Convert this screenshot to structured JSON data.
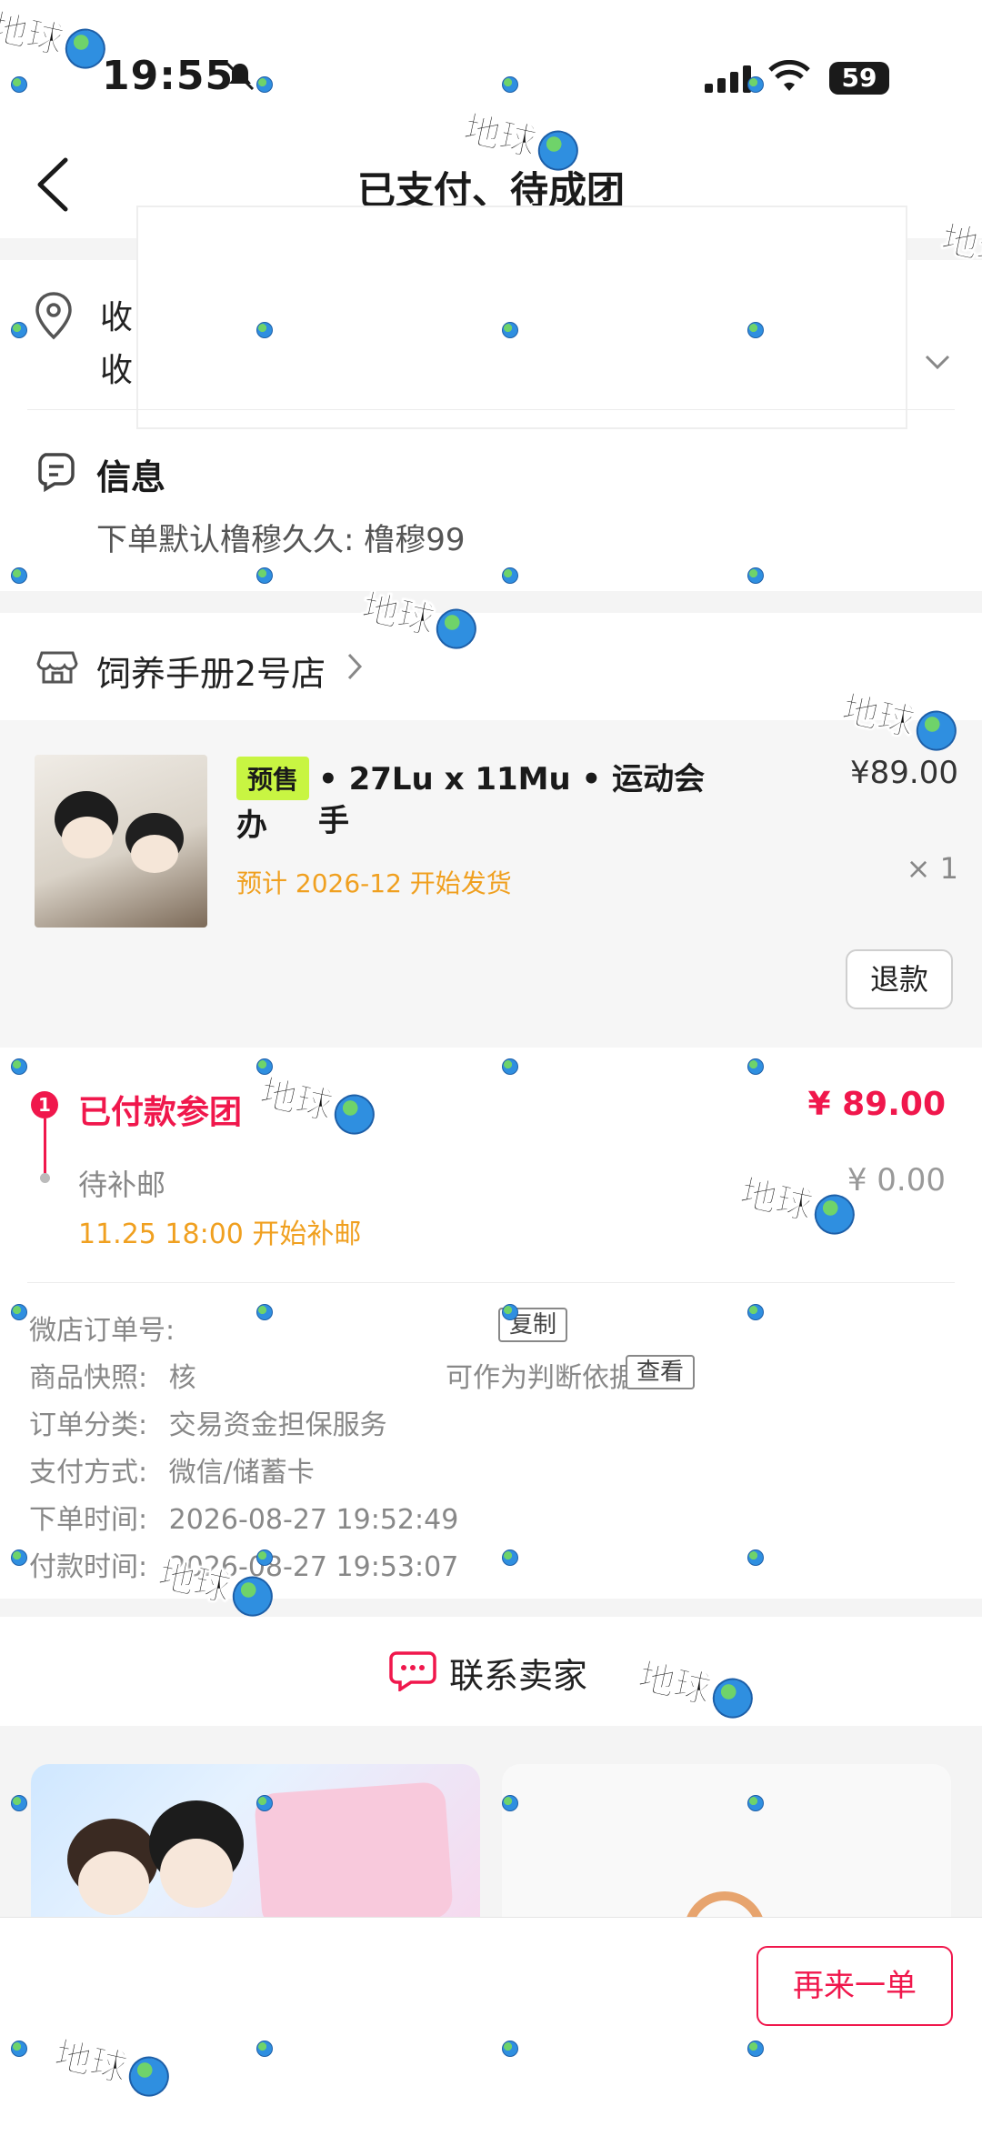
{
  "status_bar": {
    "time": "19:55",
    "battery": "59"
  },
  "nav": {
    "title": "已支付、待成团"
  },
  "address": {
    "line1": "收",
    "line2": "收"
  },
  "info": {
    "title": "信息",
    "text": "下单默认橹穆久久: 橹穆99"
  },
  "shop": {
    "name": "饲养手册2号店"
  },
  "product": {
    "tag": "预售",
    "title": "• 27Lu x 11Mu • 运动会手",
    "title_wrap": "办",
    "ship_note": "预计 2026-12 开始发货",
    "price": "¥89.00",
    "qty": "× 1",
    "refund_label": "退款"
  },
  "payment": {
    "step_number": "1",
    "step1_label": "已付款参团",
    "step1_amount": "¥ 89.00",
    "step2_label": "待补邮",
    "step2_amount": "¥ 0.00",
    "step2_note": "11.25 18:00 开始补邮"
  },
  "order_details": {
    "order_no_label": "微店订单号:",
    "copy_label": "复制",
    "snapshot_label": "商品快照:",
    "snapshot_text_a": "核",
    "snapshot_text_b": "可作为判断依据",
    "view_label": "查看",
    "category_label": "订单分类:",
    "category_value": "交易资金担保服务",
    "payment_method_label": "支付方式:",
    "payment_method_value": "微信/储蓄卡",
    "order_time_label": "下单时间:",
    "order_time_value": "2026-08-27 19:52:49",
    "pay_time_label": "付款时间:",
    "pay_time_value": "2026-08-27 19:53:07"
  },
  "contact": {
    "label": "联系卖家"
  },
  "bottom": {
    "reorder_label": "再来一单"
  },
  "watermark": {
    "text": "地球"
  },
  "colors": {
    "accent": "#f0174c",
    "orange": "#f0a020",
    "presale_tag": "#c8f542"
  }
}
